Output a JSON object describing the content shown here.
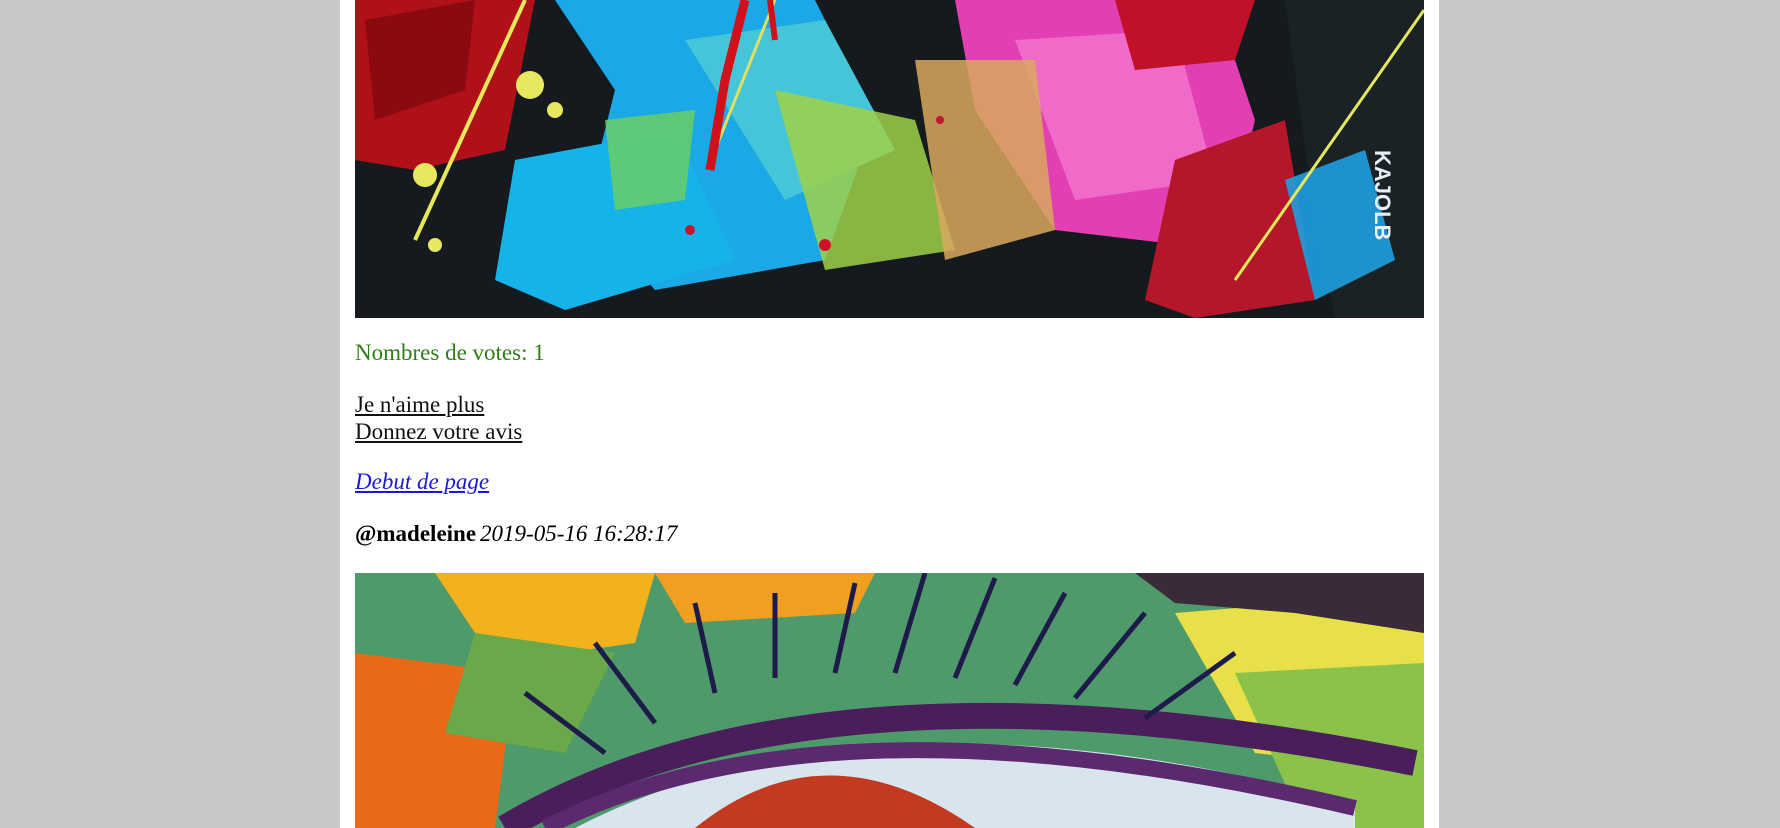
{
  "post_upper": {
    "votes_text": "Nombres de votes: 1",
    "unlike_label": "Je n'aime plus",
    "opinion_label": "Donnez votre avis",
    "top_link_label": "Debut de page",
    "signature": "KAJOLB"
  },
  "post_lower": {
    "author": "@madeleine",
    "date": "2019-05-16 16:28:17"
  },
  "colors": {
    "votes": "#2e7d16",
    "top_link": "#1a1ad6",
    "background": "#c8c8c8",
    "page": "#ffffff"
  }
}
